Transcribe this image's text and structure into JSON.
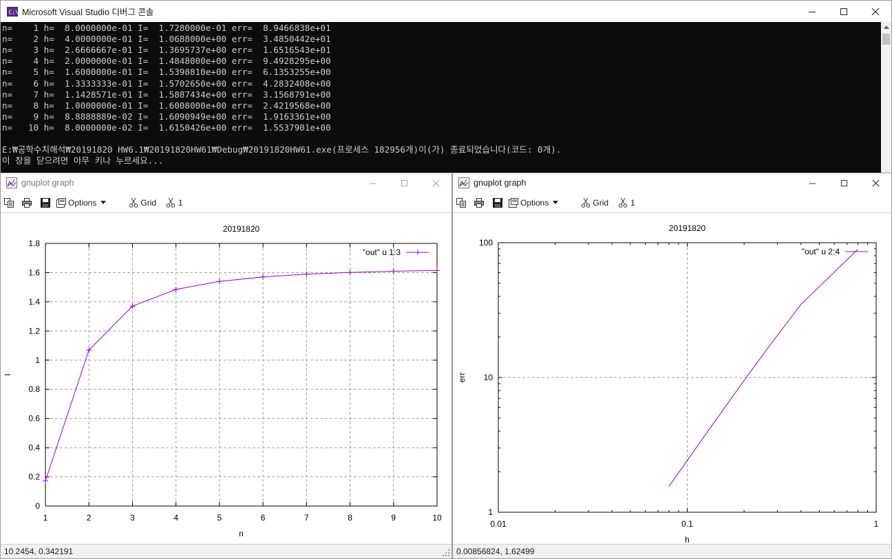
{
  "console": {
    "title": "Microsoft Visual Studio 디버그 콘솔",
    "icon": "console-app-icon",
    "lines": [
      "n=    1 h=  8.0000000e-01 I=  1.7280000e-01 err=  8.9466838e+01",
      "n=    2 h=  4.0000000e-01 I=  1.0688000e+00 err=  3.4850442e+01",
      "n=    3 h=  2.6666667e-01 I=  1.3695737e+00 err=  1.6516543e+01",
      "n=    4 h=  2.0000000e-01 I=  1.4848000e+00 err=  9.4928295e+00",
      "n=    5 h=  1.6000000e-01 I=  1.5398810e+00 err=  6.1353255e+00",
      "n=    6 h=  1.3333333e-01 I=  1.5702650e+00 err=  4.2832408e+00",
      "n=    7 h=  1.1428571e-01 I=  1.5887434e+00 err=  3.1568791e+00",
      "n=    8 h=  1.0000000e-01 I=  1.6008000e+00 err=  2.4219568e+00",
      "n=    9 h=  8.8888889e-02 I=  1.6090949e+00 err=  1.9163361e+00",
      "n=   10 h=  8.0000000e-02 I=  1.6150426e+00 err=  1.5537901e+00",
      "",
      "E:₩공학수치해석₩20191820 HW6.1₩20191820HW61₩Debug₩20191820HW61.exe(프로세스 182956개)이(가) 종료되었습니다(코드: 0개).",
      "이 창을 닫으려면 아무 키나 누르세요..."
    ],
    "text_color": "#cccccc",
    "background": "#0c0c0c"
  },
  "windows": [
    {
      "title": "gnuplot graph",
      "toolbar": {
        "options_label": "Options",
        "grid_label": "Grid",
        "one_label": "1"
      },
      "status": "10.2454,  0.342191"
    },
    {
      "title": "gnuplot graph",
      "toolbar": {
        "options_label": "Options",
        "grid_label": "Grid",
        "one_label": "1"
      },
      "status": "0.00856824,  1.62499"
    }
  ],
  "chart_data": [
    {
      "type": "line",
      "title": "20191820",
      "xlabel": "n",
      "ylabel": "I",
      "xlim": [
        1,
        10
      ],
      "ylim": [
        0,
        1.8
      ],
      "xscale": "linear",
      "yscale": "linear",
      "grid": true,
      "legend": "top-right",
      "xticks": [
        "1",
        "2",
        "3",
        "4",
        "5",
        "6",
        "7",
        "8",
        "9",
        "10"
      ],
      "yticks": [
        "0",
        "0.2",
        "0.4",
        "0.6",
        "0.8",
        "1",
        "1.2",
        "1.4",
        "1.6",
        "1.8"
      ],
      "series": [
        {
          "name": "\"out\" u 1:3",
          "color": "#9400d3",
          "markers": true,
          "x": [
            1,
            2,
            3,
            4,
            5,
            6,
            7,
            8,
            9,
            10
          ],
          "y": [
            0.1728,
            1.0688,
            1.3695737,
            1.4848,
            1.539881,
            1.570265,
            1.5887434,
            1.6008,
            1.6090949,
            1.6150426
          ]
        }
      ]
    },
    {
      "type": "line",
      "title": "20191820",
      "xlabel": "h",
      "ylabel": "err",
      "xlim": [
        0.01,
        1
      ],
      "ylim": [
        1,
        100
      ],
      "xscale": "log",
      "yscale": "log",
      "grid": true,
      "legend": "top-right",
      "xticks": [
        "0.01",
        "0.1",
        "1"
      ],
      "yticks": [
        "1",
        "10",
        "100"
      ],
      "series": [
        {
          "name": "\"out\" u 2:4",
          "color": "#9400d3",
          "markers": false,
          "x": [
            0.8,
            0.4,
            0.26666667,
            0.2,
            0.16,
            0.13333333,
            0.11428571,
            0.1,
            0.088888889,
            0.08
          ],
          "y": [
            89.466838,
            34.850442,
            16.516543,
            9.4928295,
            6.1353255,
            4.2832408,
            3.1568791,
            2.4219568,
            1.9163361,
            1.5537901
          ]
        }
      ]
    }
  ]
}
